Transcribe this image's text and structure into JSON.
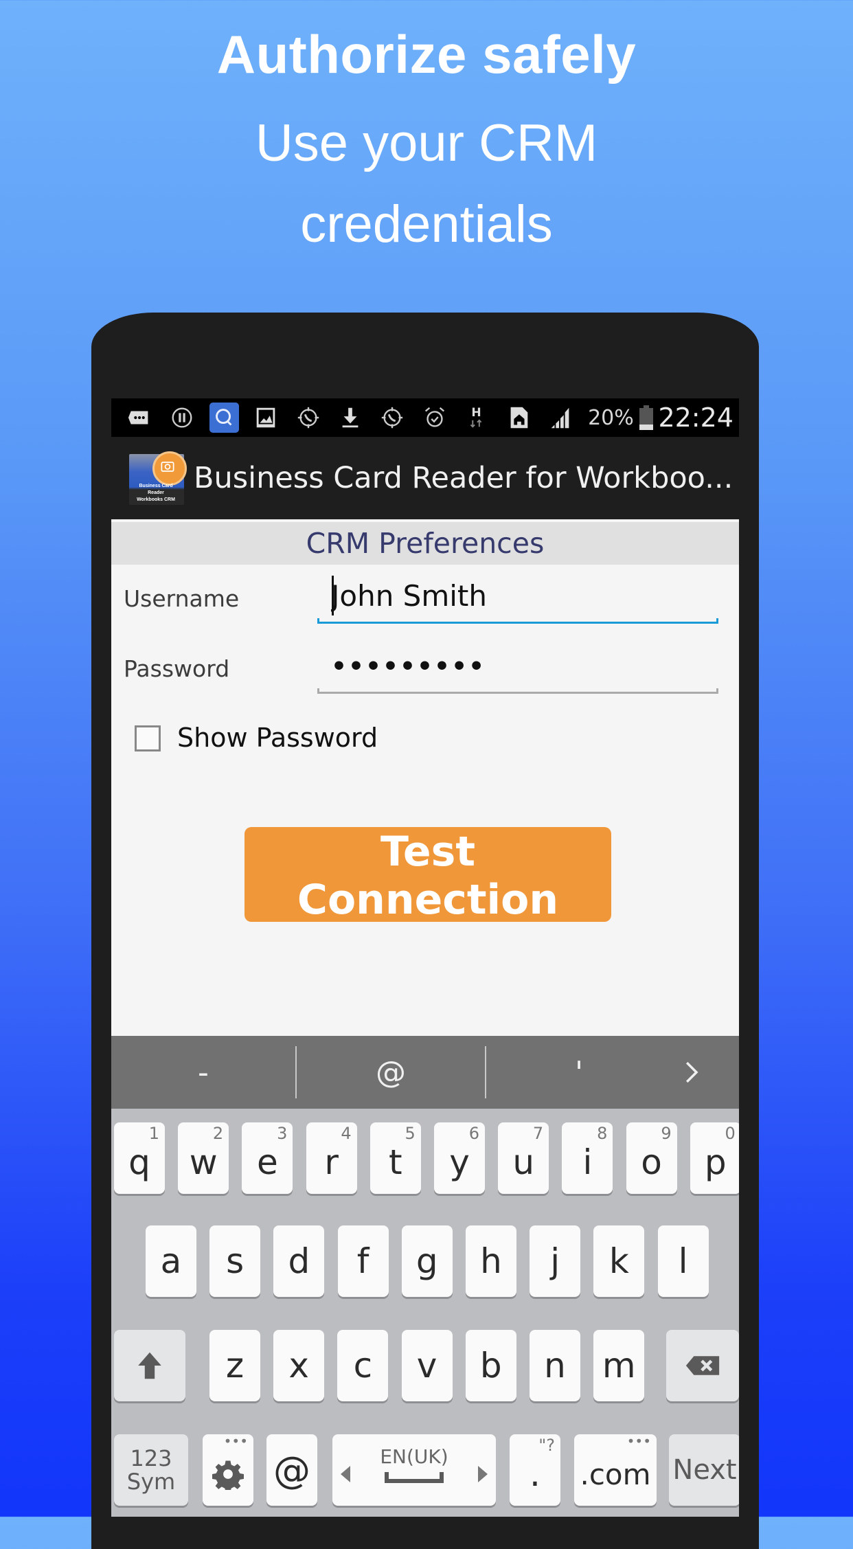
{
  "promo": {
    "title": "Authorize safely",
    "subtitle_line1": "Use your CRM",
    "subtitle_line2": "credentials"
  },
  "statusbar": {
    "icons": [
      "messages-icon",
      "pause-icon",
      "search-app-icon",
      "gallery-icon",
      "call-forward-icon",
      "download-icon",
      "call-forward-icon",
      "alarm-icon",
      "hspa-data-icon",
      "sim-home-icon",
      "signal-icon"
    ],
    "battery_percent": "20%",
    "battery_level": 0.2,
    "time": "22:24"
  },
  "appbar": {
    "title": "Business Card Reader for Workboo...",
    "icon_caption_line1": "Business Card Reader",
    "icon_caption_line2": "Workbooks CRM"
  },
  "prefs": {
    "header": "CRM Preferences",
    "username_label": "Username",
    "username_value": "John Smith",
    "password_label": "Password",
    "password_value": "•••••••••",
    "show_password_label": "Show Password",
    "show_password_checked": false,
    "test_button": "Test Connection"
  },
  "colors": {
    "button": "#f0973a",
    "header_text": "#363a6d",
    "active_underline": "#1a9ad6"
  },
  "keyboard": {
    "suggestions": [
      "-",
      "@",
      "'"
    ],
    "row1": [
      {
        "key": "q",
        "hint": "1"
      },
      {
        "key": "w",
        "hint": "2"
      },
      {
        "key": "e",
        "hint": "3"
      },
      {
        "key": "r",
        "hint": "4"
      },
      {
        "key": "t",
        "hint": "5"
      },
      {
        "key": "y",
        "hint": "6"
      },
      {
        "key": "u",
        "hint": "7"
      },
      {
        "key": "i",
        "hint": "8"
      },
      {
        "key": "o",
        "hint": "9"
      },
      {
        "key": "p",
        "hint": "0"
      }
    ],
    "row2": [
      "a",
      "s",
      "d",
      "f",
      "g",
      "h",
      "j",
      "k",
      "l"
    ],
    "row3": [
      "z",
      "x",
      "c",
      "v",
      "b",
      "n",
      "m"
    ],
    "sym_line1": "123",
    "sym_line2": "Sym",
    "at_key": "@",
    "language": "EN(UK)",
    "period_key": ".",
    "period_hint": "\"?",
    "dotcom_key": ".com",
    "next_key": "Next"
  }
}
